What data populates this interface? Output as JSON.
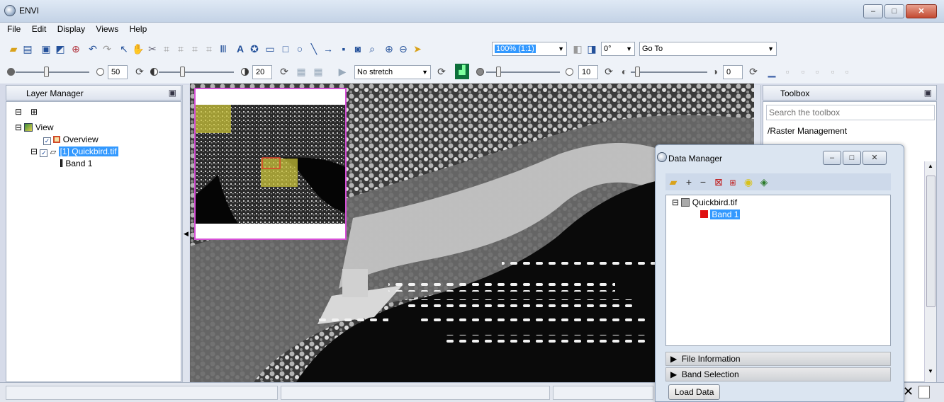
{
  "window": {
    "title": "ENVI",
    "minimize": "‒",
    "maximize": "□",
    "close": "✕"
  },
  "menu": [
    "File",
    "Edit",
    "Display",
    "Views",
    "Help"
  ],
  "toolbar": {
    "zoom_value": "100% (1:1)",
    "rotation_value": "0°",
    "goto_placeholder": "Go To"
  },
  "toolbar2": {
    "brightness_value": "50",
    "contrast_value": "20",
    "stretch_value": "No stretch",
    "sharpen_value": "10",
    "transparency_value": "0"
  },
  "layer_manager": {
    "title": "Layer Manager",
    "items": [
      "View",
      "Overview",
      "[1] Quickbird.tif",
      "Band 1"
    ]
  },
  "toolbox": {
    "title": "Toolbox",
    "search_placeholder": "Search the toolbox",
    "items": [
      "/Raster Management"
    ]
  },
  "data_manager": {
    "title": "Data Manager",
    "files": [
      {
        "name": "Quickbird.tif",
        "bands": [
          "Band 1"
        ]
      }
    ],
    "sections": [
      "File Information",
      "Band Selection"
    ],
    "load_button": "Load Data"
  },
  "colors": {
    "accent_blue": "#3399ff",
    "overview_border": "#d64fd6",
    "overview_box": "#c8c23a"
  }
}
